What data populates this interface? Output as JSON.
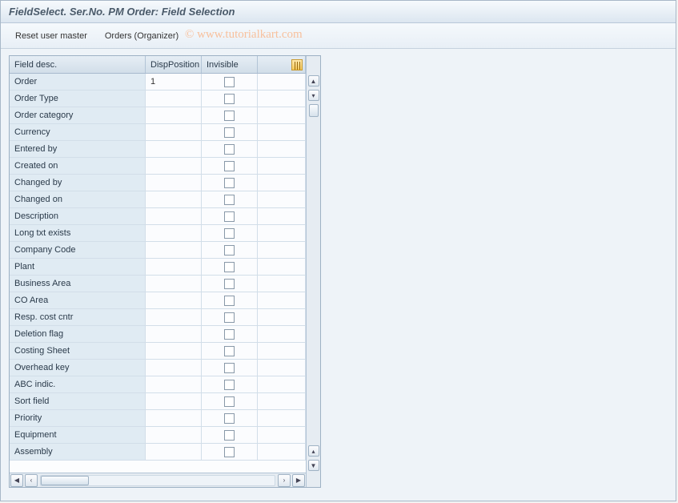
{
  "window": {
    "title": "FieldSelect. Ser.No. PM Order: Field Selection"
  },
  "toolbar": {
    "reset_label": "Reset user master",
    "orders_label": "Orders (Organizer)"
  },
  "watermark": "© www.tutorialkart.com",
  "grid": {
    "headers": {
      "field_desc": "Field desc.",
      "disp_position": "DispPosition",
      "invisible": "Invisible"
    },
    "rows": [
      {
        "desc": "Order",
        "pos": "1",
        "invisible": false
      },
      {
        "desc": "Order Type",
        "pos": "",
        "invisible": false
      },
      {
        "desc": "Order category",
        "pos": "",
        "invisible": false
      },
      {
        "desc": "Currency",
        "pos": "",
        "invisible": false
      },
      {
        "desc": "Entered by",
        "pos": "",
        "invisible": false
      },
      {
        "desc": "Created on",
        "pos": "",
        "invisible": false
      },
      {
        "desc": "Changed by",
        "pos": "",
        "invisible": false
      },
      {
        "desc": "Changed on",
        "pos": "",
        "invisible": false
      },
      {
        "desc": "Description",
        "pos": "",
        "invisible": false
      },
      {
        "desc": "Long txt exists",
        "pos": "",
        "invisible": false
      },
      {
        "desc": "Company Code",
        "pos": "",
        "invisible": false
      },
      {
        "desc": "Plant",
        "pos": "",
        "invisible": false
      },
      {
        "desc": "Business Area",
        "pos": "",
        "invisible": false
      },
      {
        "desc": "CO Area",
        "pos": "",
        "invisible": false
      },
      {
        "desc": "Resp. cost cntr",
        "pos": "",
        "invisible": false
      },
      {
        "desc": "Deletion flag",
        "pos": "",
        "invisible": false
      },
      {
        "desc": "Costing Sheet",
        "pos": "",
        "invisible": false
      },
      {
        "desc": "Overhead key",
        "pos": "",
        "invisible": false
      },
      {
        "desc": "ABC indic.",
        "pos": "",
        "invisible": false
      },
      {
        "desc": "Sort field",
        "pos": "",
        "invisible": false
      },
      {
        "desc": "Priority",
        "pos": "",
        "invisible": false
      },
      {
        "desc": "Equipment",
        "pos": "",
        "invisible": false
      },
      {
        "desc": "Assembly",
        "pos": "",
        "invisible": false
      }
    ]
  }
}
